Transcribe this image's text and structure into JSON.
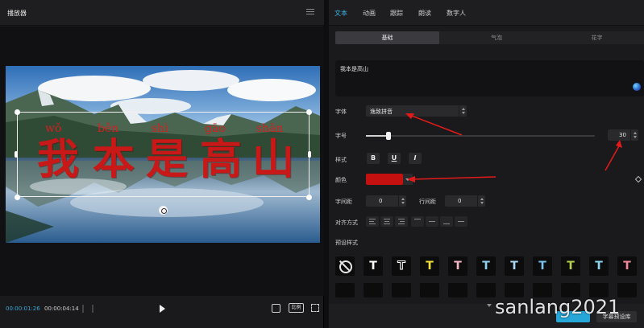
{
  "player": {
    "title": "播放器",
    "timecode_current": "00:00:01:26",
    "timecode_total": "00:00:04:14",
    "ratio_label": "比例"
  },
  "subtitle": {
    "pinyin": [
      "wǒ",
      "běn",
      "shì",
      "gāo",
      "shān"
    ],
    "characters": [
      "我",
      "本",
      "是",
      "高",
      "山"
    ]
  },
  "tabs": [
    {
      "label": "文本",
      "active": true
    },
    {
      "label": "动画",
      "active": false
    },
    {
      "label": "跟踪",
      "active": false
    },
    {
      "label": "朗读",
      "active": false
    },
    {
      "label": "数字人",
      "active": false
    }
  ],
  "subtabs": [
    {
      "label": "基础",
      "active": true
    },
    {
      "label": "气泡",
      "active": false
    },
    {
      "label": "花字",
      "active": false
    }
  ],
  "text_input": {
    "value": "我本是高山"
  },
  "font": {
    "label": "字体",
    "value": "逸致拼音"
  },
  "size": {
    "label": "字号",
    "value": "30",
    "slider_fraction": 0.1
  },
  "style": {
    "label": "样式",
    "bold": "B",
    "underline": "U",
    "italic": "I"
  },
  "color": {
    "label": "颜色",
    "value": "#c51010"
  },
  "spacing": {
    "letter_label": "字间距",
    "letter_value": "0",
    "line_label": "行间距",
    "line_value": "0"
  },
  "align": {
    "label": "对齐方式"
  },
  "presets": {
    "label": "预设样式",
    "items": [
      {
        "icon": "none-icon",
        "color": "#e6e6e6",
        "glyph": ""
      },
      {
        "icon": "t-white-icon",
        "color": "#ffffff",
        "glyph": "T"
      },
      {
        "icon": "t-outline-icon",
        "color": "#0c0c0d",
        "glyph": "T"
      },
      {
        "icon": "t-yellow-icon",
        "color": "#f2e23a",
        "glyph": "T"
      },
      {
        "icon": "t-pink-icon",
        "color": "#f6b6c6",
        "glyph": "T"
      },
      {
        "icon": "t-blue-icon",
        "color": "#8fd0f5",
        "glyph": "T"
      },
      {
        "icon": "t-lightblue-icon",
        "color": "#a8d8f8",
        "glyph": "T"
      },
      {
        "icon": "t-skyblue-icon",
        "color": "#7ac3ee",
        "glyph": "T"
      },
      {
        "icon": "t-green-icon",
        "color": "#b3d24a",
        "glyph": "T"
      },
      {
        "icon": "t-cyan-icon",
        "color": "#8ed6f0",
        "glyph": "T"
      },
      {
        "icon": "t-red-icon",
        "color": "#f08a9a",
        "glyph": "T"
      }
    ]
  },
  "footer": {
    "primary_label": "",
    "secondary_label": "字幕预设库"
  },
  "watermark": "sanlang2021",
  "colors": {
    "accent": "#3bb4e6",
    "annotation_arrow": "#e21a1a"
  }
}
